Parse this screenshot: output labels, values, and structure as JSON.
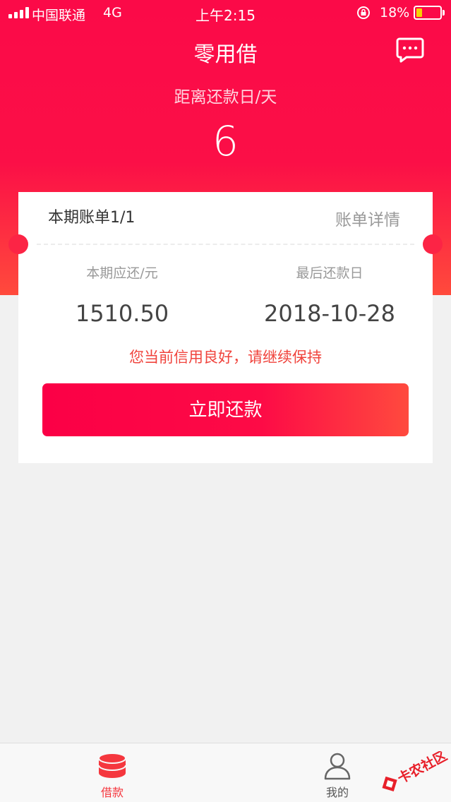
{
  "status_bar": {
    "carrier": "中国联通",
    "network": "4G",
    "time": "上午2:15",
    "battery_percent": "18%",
    "battery_level": 0.18,
    "icons": [
      "signal-icon",
      "rotation-lock-icon",
      "battery-icon"
    ]
  },
  "header": {
    "title": "零用借",
    "countdown_label": "距离还款日/天",
    "countdown_value": "6",
    "message_icon": "message-icon"
  },
  "bill": {
    "title": "本期账单1/1",
    "detail_link": "账单详情",
    "amount_label": "本期应还/元",
    "amount_value": "1510.50",
    "due_label": "最后还款日",
    "due_value": "2018-10-28",
    "credit_message": "您当前信用良好，请继续保持",
    "repay_button": "立即还款"
  },
  "tabbar": {
    "items": [
      {
        "label": "借款",
        "icon": "coins-icon",
        "active": true
      },
      {
        "label": "我的",
        "icon": "user-icon",
        "active": false
      }
    ]
  },
  "watermark": {
    "text": "卡农社区"
  },
  "colors": {
    "brand": "#fb0a48",
    "accent_end": "#ff4a3c",
    "credit_text": "#f0433c",
    "page_bg": "#f1f1f1"
  }
}
